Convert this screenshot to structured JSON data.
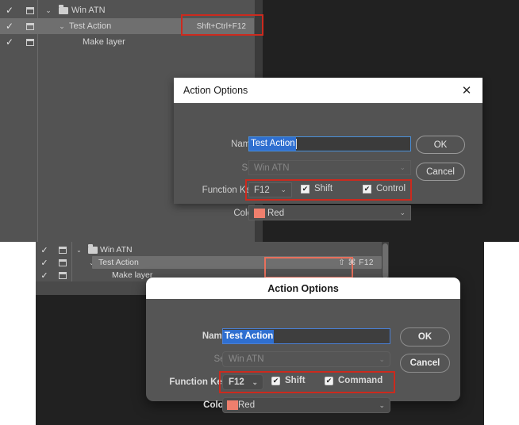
{
  "windows_view": {
    "actions_panel": {
      "rows": [
        {
          "checkmark": "✓",
          "toggle_box": "box-icon",
          "disclosure": "⌄",
          "icon": "folder-icon",
          "label": "Win ATN",
          "shortcut": "",
          "selected": false
        },
        {
          "checkmark": "✓",
          "toggle_box": "box-icon",
          "disclosure": "⌄",
          "icon": "",
          "label": "Test Action",
          "shortcut": "Shft+Ctrl+F12",
          "selected": true
        },
        {
          "checkmark": "✓",
          "toggle_box": "box-icon",
          "disclosure": "",
          "icon": "",
          "label": "Make layer",
          "shortcut": "",
          "selected": false
        }
      ]
    },
    "dialog": {
      "title": "Action Options",
      "close_label": "✕",
      "name_label": "Name:",
      "name_value": "Test Action",
      "set_label": "Set:",
      "set_value": "Win ATN",
      "function_key_label": "Function Key:",
      "function_key_value": "F12",
      "shift_label": "Shift",
      "shift_checked": "✔",
      "modifier_label": "Control",
      "modifier_checked": "✔",
      "color_label": "Color:",
      "color_value": "Red",
      "color_swatch": "#ef7f6d",
      "ok_label": "OK",
      "cancel_label": "Cancel",
      "chevron": "⌄"
    }
  },
  "mac_view": {
    "actions_panel": {
      "rows": [
        {
          "checkmark": "✓",
          "toggle_box": "box-icon",
          "disclosure": "⌄",
          "icon": "folder-icon",
          "label": "Win ATN",
          "shortcut": "",
          "selected": false
        },
        {
          "checkmark": "✓",
          "toggle_box": "box-icon",
          "disclosure": "⌄",
          "icon": "",
          "label": "Test Action",
          "shortcut": "⇧ ⌘ F12",
          "selected": true
        },
        {
          "checkmark": "✓",
          "toggle_box": "box-icon",
          "disclosure": "",
          "icon": "",
          "label": "Make layer",
          "shortcut": "",
          "selected": false
        }
      ]
    },
    "dialog": {
      "title": "Action Options",
      "name_label": "Name:",
      "name_value": "Test Action",
      "set_label": "Set:",
      "set_value": "Win ATN",
      "function_key_label": "Function Key:",
      "function_key_value": "F12",
      "shift_label": "Shift",
      "shift_checked": "✔",
      "modifier_label": "Command",
      "modifier_checked": "✔",
      "color_label": "Color:",
      "color_value": "Red",
      "color_swatch": "#ef7f6d",
      "ok_label": "OK",
      "cancel_label": "Cancel",
      "chevron": "⌄"
    }
  },
  "highlights": {
    "windows_shortcut_color": "#cc2a1e",
    "windows_funckey_color": "#cc2a1e",
    "mac_shortcut_color": "#e8705c",
    "mac_funckey_color": "#cc2a1e"
  }
}
